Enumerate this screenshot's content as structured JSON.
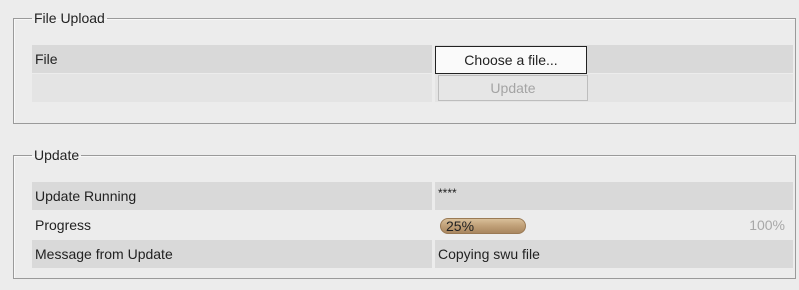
{
  "file_upload": {
    "legend": "File Upload",
    "file_label": "File",
    "choose_button": "Choose a file...",
    "update_button": "Update"
  },
  "update_section": {
    "legend": "Update",
    "rows": [
      {
        "label": "Update Running",
        "value": "****"
      },
      {
        "label": "Progress",
        "value": "25%",
        "max_label": "100%",
        "progress_fraction": 0.25
      },
      {
        "label": "Message from Update",
        "value": "Copying swu file"
      }
    ]
  },
  "colors": {
    "progress_fill": "#c2a27a",
    "row_shade": "#d9d9d9",
    "background": "#ececec"
  }
}
